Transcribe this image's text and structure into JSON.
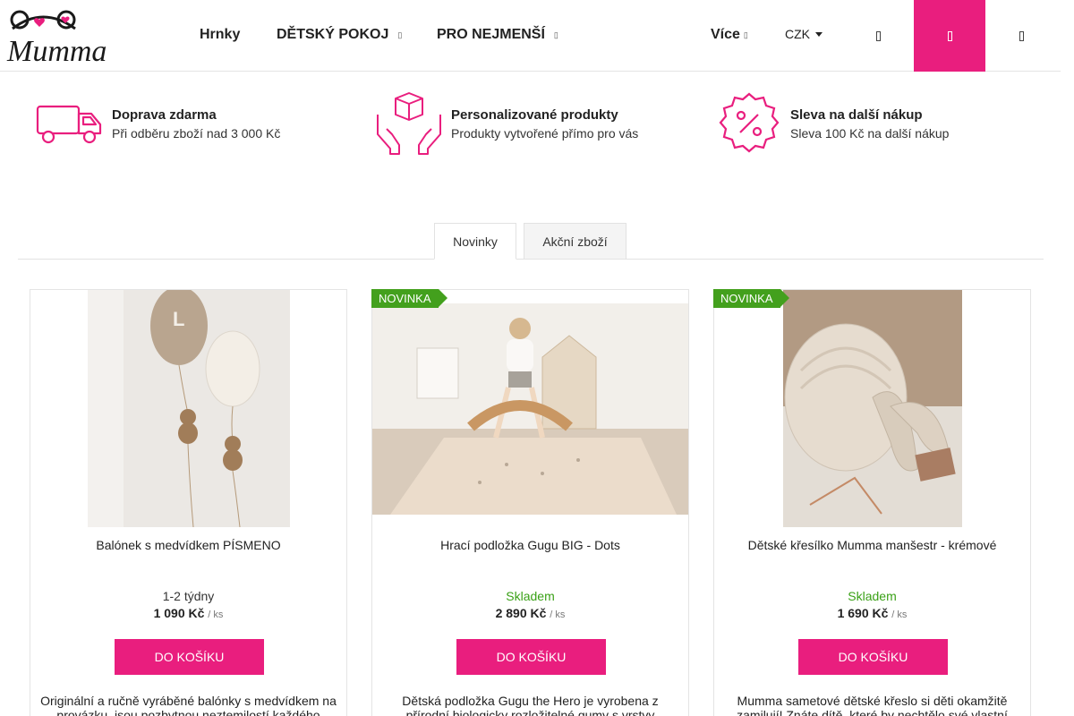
{
  "header": {
    "logo_text": "Mumma",
    "nav": [
      {
        "label": "Hrnky"
      },
      {
        "label": "DĚTSKÝ POKOJ",
        "icon": "chevron-down-icon"
      },
      {
        "label": "PRO NEJMENŠÍ",
        "icon": "chevron-down-icon"
      }
    ],
    "more_label": "Více",
    "currency": "CZK",
    "icons": [
      "search-icon",
      "cart-icon",
      "user-icon"
    ],
    "accent_color": "#e91e7e"
  },
  "benefits": [
    {
      "icon": "truck-icon",
      "title": "Doprava zdarma",
      "text": "Při odběru zboží nad 3 000 Kč"
    },
    {
      "icon": "gift-hands-icon",
      "title": "Personalizované produkty",
      "text": "Produkty vytvořené přímo pro vás"
    },
    {
      "icon": "percent-badge-icon",
      "title": "Sleva na další nákup",
      "text": "Sleva 100 Kč na další nákup"
    }
  ],
  "tabs": [
    {
      "label": "Novinky",
      "active": true
    },
    {
      "label": "Akční zboží",
      "active": false
    }
  ],
  "products": [
    {
      "flag": "",
      "name": "Balónek s medvídkem PÍSMENO",
      "availability": "1-2 týdny",
      "in_stock": false,
      "price": "1 090 Kč",
      "unit": "/ ks",
      "button": "DO KOŠÍKU",
      "description": "Originální a ručně vyráběné balónky s medvídkem na provázku, jsou pozbytnou neztemilostí každého"
    },
    {
      "flag": "NOVINKA",
      "name": "Hrací podložka Gugu BIG - Dots",
      "availability": "Skladem",
      "in_stock": true,
      "price": "2 890 Kč",
      "unit": "/ ks",
      "button": "DO KOŠÍKU",
      "description": "Dětská podložka Gugu the Hero je vyrobena z přírodní biologicky rozložitelné gumy s vrstvy"
    },
    {
      "flag": "NOVINKA",
      "name": "Dětské křesílko Mumma manšestr - krémové",
      "availability": "Skladem",
      "in_stock": true,
      "price": "1 690 Kč",
      "unit": "/ ks",
      "button": "DO KOŠÍKU",
      "description": "Mumma sametové dětské křeslo si děti okamžitě zamilují! Znáte dítě, které by nechtělo své vlastní"
    }
  ]
}
